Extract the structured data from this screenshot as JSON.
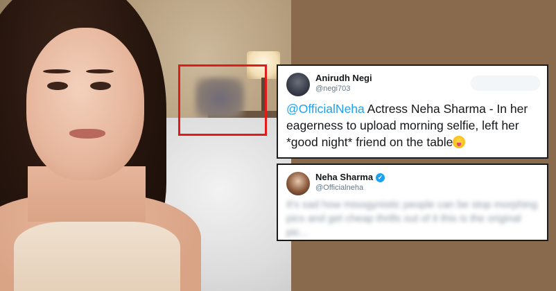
{
  "tweets": [
    {
      "name": "Anirudh Negi",
      "handle": "@negi703",
      "mention": "@OfficialNeha",
      "text": " Actress Neha Sharma - In her eagerness to upload morning selfie, left her *good night* friend on the table",
      "emoji": "squinting-face-with-tongue"
    },
    {
      "name": "Neha Sharma",
      "handle": "@Officialneha",
      "verified_icon": "verified-badge-icon",
      "blurred_text": "It's sad how misogynistic people can be stop morphing pics and get cheap thrills out of it this is the original pic..."
    }
  ],
  "colors": {
    "background": "#8a6a4c",
    "highlight": "#e31a1a",
    "mention": "#1da1f2",
    "verified": "#1da1f2"
  }
}
